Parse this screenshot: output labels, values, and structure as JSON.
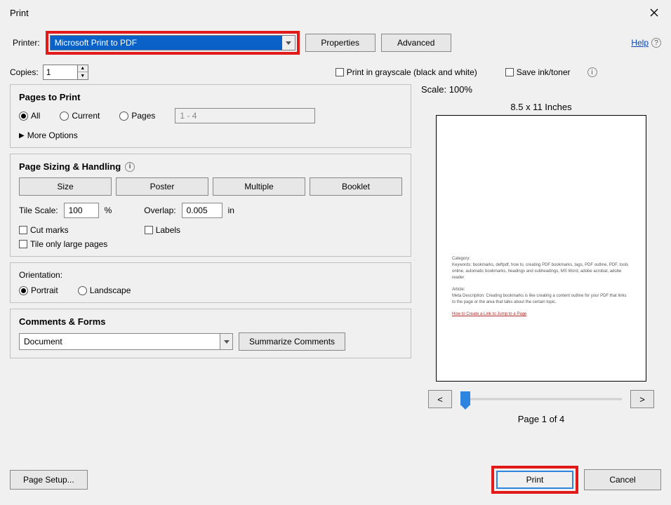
{
  "title": "Print",
  "printerLabel": "Printer:",
  "printerSelected": "Microsoft Print to PDF",
  "propertiesBtn": "Properties",
  "advancedBtn": "Advanced",
  "helpLink": "Help",
  "copiesLabel": "Copies:",
  "copiesValue": "1",
  "grayscaleLabel": "Print in grayscale (black and white)",
  "saveInkLabel": "Save ink/toner",
  "pagesToPrint": {
    "title": "Pages to Print",
    "all": "All",
    "current": "Current",
    "pages": "Pages",
    "pagesRange": "1 - 4",
    "moreOptions": "More Options"
  },
  "sizing": {
    "title": "Page Sizing & Handling",
    "size": "Size",
    "poster": "Poster",
    "multiple": "Multiple",
    "booklet": "Booklet",
    "tileScaleLabel": "Tile Scale:",
    "tileScaleValue": "100",
    "pct": "%",
    "overlapLabel": "Overlap:",
    "overlapValue": "0.005",
    "inUnit": "in",
    "cutMarks": "Cut marks",
    "labels": "Labels",
    "tileLarge": "Tile only large pages"
  },
  "orientation": {
    "title": "Orientation:",
    "portrait": "Portrait",
    "landscape": "Landscape"
  },
  "comments": {
    "title": "Comments & Forms",
    "value": "Document",
    "summarize": "Summarize Comments"
  },
  "preview": {
    "scale": "Scale: 100%",
    "dims": "8.5 x 11 Inches",
    "body1": "Category:",
    "body2": "Keywords: bookmarks, deftpdf, how to, creating PDF bookmarks, tags, PDF outline, PDF, tools online, automatic bookmarks, headings and subheadings, MS Word, adobe acrobat, adobe reader",
    "body3": "Article:",
    "body4": "Meta Description: Creating bookmarks is like creating a content outline for your PDF that links to the page or the area that talks about the certain topic.",
    "link1": "How to Create a Link to Jump to a Page",
    "pageOf": "Page 1 of 4"
  },
  "footer": {
    "pageSetup": "Page Setup...",
    "print": "Print",
    "cancel": "Cancel"
  }
}
